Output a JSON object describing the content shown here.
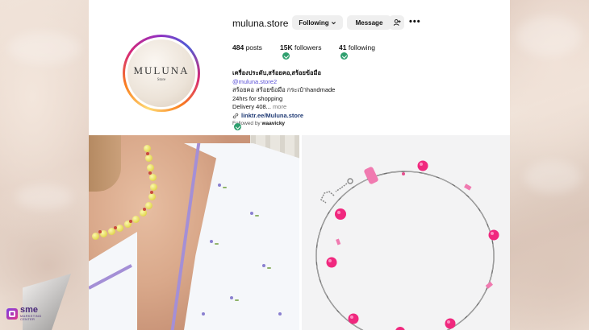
{
  "profile": {
    "username": "muluna.store",
    "avatar_logo": "MULUNA",
    "avatar_logo_sub": "Store",
    "buttons": {
      "following": "Following",
      "following_icon": "chevron-down-icon",
      "message": "Message",
      "add_user_icon": "add-person-icon",
      "more_icon": "more-horizontal-icon",
      "more_glyph": "•••"
    },
    "stats": [
      {
        "value": "484",
        "label": "posts"
      },
      {
        "value": "15K",
        "label": "followers"
      },
      {
        "value": "41",
        "label": "following"
      }
    ],
    "bio": {
      "name": "เครื่องประดับ,สร้อยคอ,สร้อยข้อมือ",
      "handle": "@muluna.store2",
      "line1": "สร้อยคอ สร้อยข้อมือ กระเป๋าhandmade",
      "line2": "24hrs for shopping",
      "line3": "Delivery 408...",
      "more": "more",
      "link": "linktr.ee/Muluna.store",
      "followed_by_prefix": "Followed by",
      "followed_by_user": "waavicky"
    }
  },
  "branding": {
    "sme_big": "sme",
    "sme_small": "MARKETING CENTER"
  },
  "colors": {
    "accent_check": "#2e9f6e",
    "handle": "#5b51d8",
    "pink_bead": "#f0287e",
    "yellow_bead": "#e6dc5c",
    "trim": "#a48fd6"
  }
}
